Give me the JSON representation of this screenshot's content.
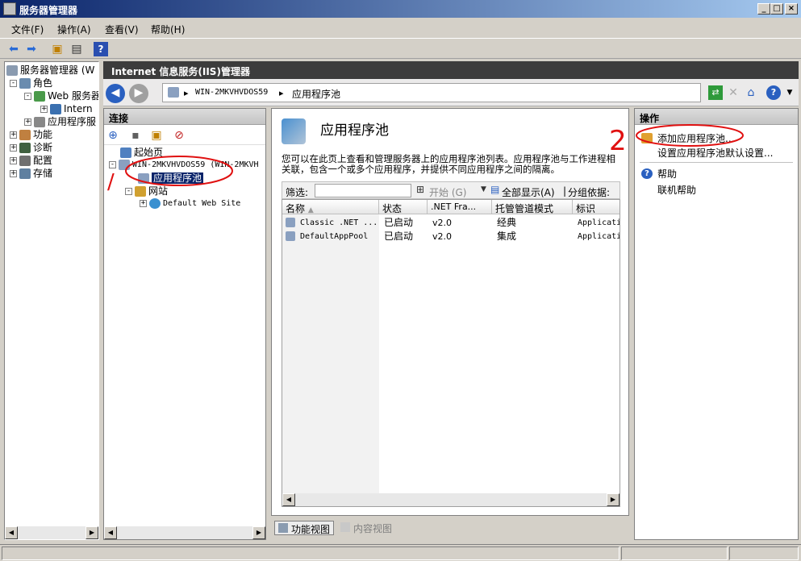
{
  "window": {
    "title": "服务器管理器"
  },
  "menu": [
    "文件(F)",
    "操作(A)",
    "查看(V)",
    "帮助(H)"
  ],
  "tree": {
    "root": "服务器管理器 (W",
    "roles": "角色",
    "web": "Web 服务器",
    "iis": "Intern",
    "apppool": "应用程序服",
    "features": "功能",
    "diag": "诊断",
    "config": "配置",
    "storage": "存储"
  },
  "iis": {
    "title": "Internet 信息服务(IIS)管理器",
    "breadcrumb": [
      "WIN-2MKVHVDOS59",
      "应用程序池"
    ]
  },
  "connections": {
    "title": "连接",
    "start": "起始页",
    "server": "WIN-2MKVHVDOS59 (WIN-2MKVH",
    "apppools": "应用程序池",
    "sites": "网站",
    "site1": "Default Web Site"
  },
  "main": {
    "title": "应用程序池",
    "description": "您可以在此页上查看和管理服务器上的应用程序池列表。应用程序池与工作进程相关联，包含一个或多个应用程序，并提供不同应用程序之间的隔离。",
    "filter": {
      "label": "筛选:",
      "start": "开始 (G)",
      "showall": "全部显示(A)",
      "groupby": "分组依据:"
    },
    "columns": [
      "名称",
      "状态",
      ".NET Fra...",
      "托管管道模式",
      "标识"
    ],
    "rows": [
      [
        "Classic .NET ...",
        "已启动",
        "v2.0",
        "经典",
        "Applicati"
      ],
      [
        "DefaultAppPool",
        "已启动",
        "v2.0",
        "集成",
        "Applicati"
      ]
    ]
  },
  "viewtabs": {
    "feature": "功能视图",
    "content": "内容视图"
  },
  "actions": {
    "title": "操作",
    "add": "添加应用程序池...",
    "defaults": "设置应用程序池默认设置...",
    "help": "帮助",
    "onlinehelp": "联机帮助"
  },
  "annotations": {
    "one": "/",
    "two": "2"
  }
}
